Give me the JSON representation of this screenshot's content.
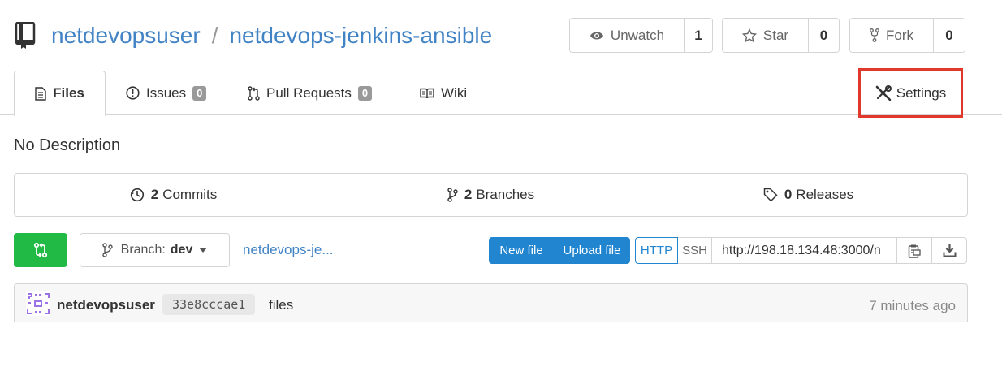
{
  "repo": {
    "owner": "netdevopsuser",
    "separator": "/",
    "name": "netdevops-jenkins-ansible"
  },
  "actions": {
    "watch": {
      "label": "Unwatch",
      "count": "1"
    },
    "star": {
      "label": "Star",
      "count": "0"
    },
    "fork": {
      "label": "Fork",
      "count": "0"
    }
  },
  "tabs": {
    "files": {
      "label": "Files"
    },
    "issues": {
      "label": "Issues",
      "count": "0"
    },
    "pulls": {
      "label": "Pull Requests",
      "count": "0"
    },
    "wiki": {
      "label": "Wiki"
    },
    "settings": {
      "label": "Settings"
    }
  },
  "description": "No Description",
  "stats": {
    "commits": {
      "count": "2",
      "label": "Commits"
    },
    "branches": {
      "count": "2",
      "label": "Branches"
    },
    "releases": {
      "count": "0",
      "label": "Releases"
    }
  },
  "branch": {
    "prefix": "Branch:",
    "name": "dev"
  },
  "path_link": "netdevops-je...",
  "file_actions": {
    "new_file": "New file",
    "upload_file": "Upload file"
  },
  "clone": {
    "http": "HTTP",
    "ssh": "SSH",
    "url": "http://198.18.134.48:3000/n"
  },
  "latest_commit": {
    "author": "netdevopsuser",
    "sha": "33e8cccae1",
    "message": "files",
    "time": "7 minutes ago"
  },
  "colors": {
    "link": "#4183c4",
    "primary": "#2185d0",
    "green": "#21ba45",
    "highlight": "#e0382b"
  }
}
